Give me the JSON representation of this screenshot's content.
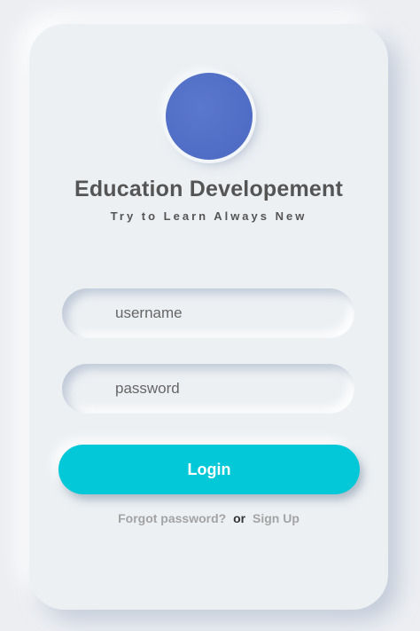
{
  "header": {
    "title": "Education Developement",
    "subtitle": "Try to Learn Always New"
  },
  "form": {
    "username_placeholder": "username",
    "password_placeholder": "password",
    "login_label": "Login"
  },
  "footer": {
    "forgot_label": "Forgot password?",
    "or_label": "or",
    "signup_label": "Sign Up"
  },
  "colors": {
    "background": "#ecf0f3",
    "accent": "#03c8d8",
    "logo": "#5471c9",
    "text": "#555555",
    "link": "#a3a3a3"
  },
  "icons": {
    "logo": "logo-circle"
  }
}
